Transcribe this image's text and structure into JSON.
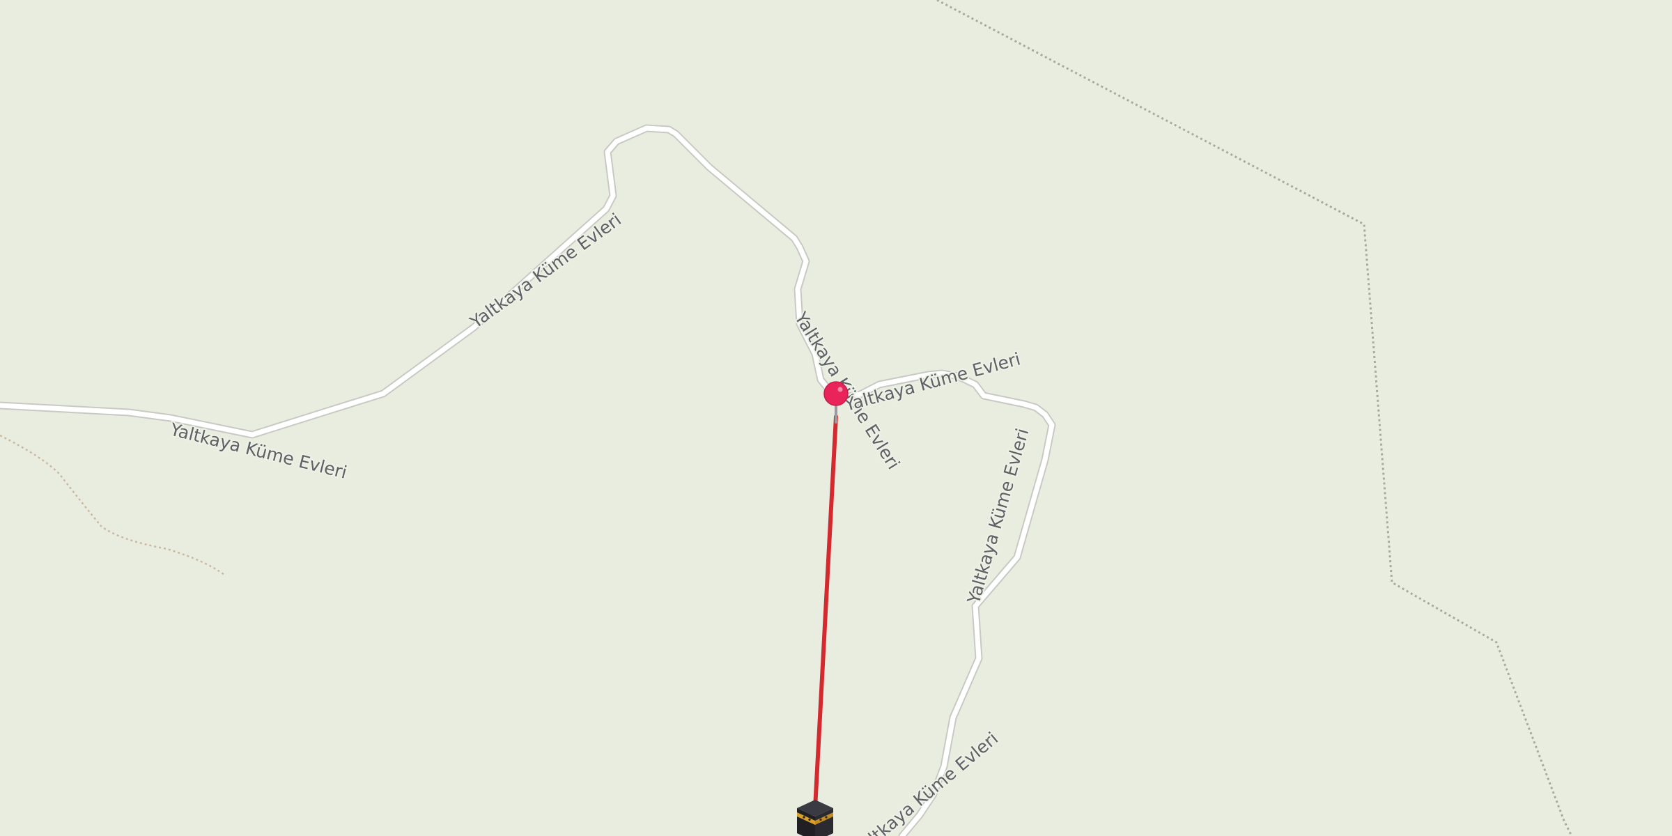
{
  "map": {
    "road_name": "Yaltkaya Küme Evleri",
    "colors": {
      "background": "#e9ede0",
      "road": "#ffffff",
      "road_casing": "#c9c9c4",
      "boundary": "#a8aa9e",
      "track": "#c9b9a2",
      "direction_line": "#d42a2f",
      "marker": "#e8245a",
      "kaaba_cloth": "#1f1f24",
      "kaaba_band": "#d9a12c"
    },
    "markers": {
      "location": "location-pin-icon",
      "destination": "kaaba-icon"
    }
  }
}
